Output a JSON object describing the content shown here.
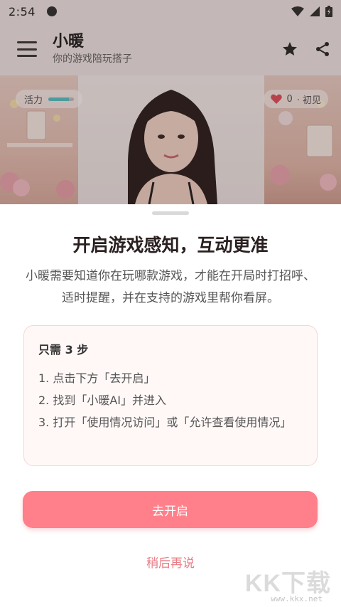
{
  "status_bar": {
    "time": "2:54"
  },
  "header": {
    "title": "小暖",
    "subtitle": "你的游戏陪玩搭子",
    "icons": [
      "menu-icon",
      "star-icon",
      "share-icon"
    ]
  },
  "scene": {
    "vitality_label": "活力",
    "vitality_level": 0.8,
    "affinity_value": "0",
    "affinity_stage": "· 初见"
  },
  "sheet": {
    "title": "开启游戏感知，互动更准",
    "description": "小暖需要知道你在玩哪款游戏，才能在开局时打招呼、适时提醒，并在支持的游戏里帮你看屏。",
    "steps_heading": "只需 3 步",
    "steps": [
      "1. 点击下方「去开启」",
      "2. 找到「小暖AI」并进入",
      "3. 打开「使用情况访问」或「允许查看使用情况」"
    ],
    "primary_button": "去开启",
    "secondary_link": "稍后再说"
  },
  "watermark": {
    "logo_text": "KK下载",
    "url": "www.kkx.net"
  },
  "colors": {
    "accent": "#ff7f8a",
    "accent_text": "#e97d86",
    "card_bg": "#fff8f7",
    "vitality": "#59c2c6"
  }
}
